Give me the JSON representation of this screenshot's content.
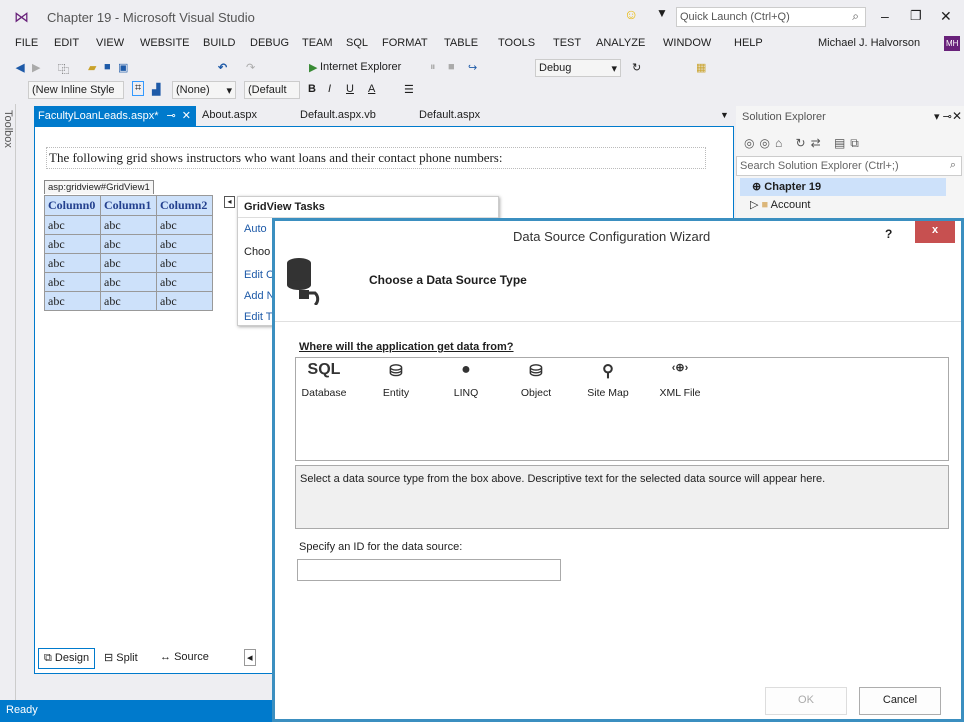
{
  "title": {
    "text": "Chapter 19 - Microsoft Visual Studio",
    "quick_launch": "Quick Launch (Ctrl+Q)",
    "user": "Michael J. Halvorson",
    "user_badge": "MH"
  },
  "menu": [
    "FILE",
    "EDIT",
    "VIEW",
    "WEBSITE",
    "BUILD",
    "DEBUG",
    "TEAM",
    "SQL",
    "FORMAT",
    "TABLE",
    "TOOLS",
    "TEST",
    "ANALYZE",
    "WINDOW",
    "HELP"
  ],
  "toolbar": {
    "browser": "Internet Explorer",
    "config": "Debug",
    "style": "(New Inline Style",
    "target": "(None)",
    "font": "(Default"
  },
  "toolbox_label": "Toolbox",
  "tabs": [
    {
      "label": "FacultyLoanLeads.aspx*"
    },
    {
      "label": "About.aspx"
    },
    {
      "label": "Default.aspx.vb"
    },
    {
      "label": "Default.aspx"
    }
  ],
  "editor": {
    "intro": "The following grid shows instructors who want loans and their contact phone numbers:",
    "grid_tag": "asp:gridview#GridView1",
    "columns": [
      "Column0",
      "Column1",
      "Column2"
    ],
    "rows": [
      [
        "abc",
        "abc",
        "abc"
      ],
      [
        "abc",
        "abc",
        "abc"
      ],
      [
        "abc",
        "abc",
        "abc"
      ],
      [
        "abc",
        "abc",
        "abc"
      ],
      [
        "abc",
        "abc",
        "abc"
      ]
    ],
    "tasks_title": "GridView Tasks",
    "tasks": [
      "Auto",
      "Choo",
      "Edit C",
      "Add N",
      "Edit T"
    ]
  },
  "views": {
    "design": "Design",
    "split": "Split",
    "source": "Source"
  },
  "solution": {
    "title": "Solution Explorer",
    "search": "Search Solution Explorer (Ctrl+;)",
    "root": "Chapter 19",
    "item1": "Account"
  },
  "status": "Ready",
  "wizard": {
    "title": "Data Source Configuration Wizard",
    "help": "?",
    "close": "x",
    "heading": "Choose a Data Source Type",
    "question": "Where will the application get data from?",
    "types": [
      {
        "label": "Database",
        "icon": "SQL"
      },
      {
        "label": "Entity",
        "icon": "entity-icon"
      },
      {
        "label": "LINQ",
        "icon": "linq-icon"
      },
      {
        "label": "Object",
        "icon": "object-icon"
      },
      {
        "label": "Site Map",
        "icon": "sitemap-icon"
      },
      {
        "label": "XML File",
        "icon": "‹⊕›"
      }
    ],
    "description": "Select a data source type from the box above. Descriptive text for the selected data source will appear here.",
    "id_label": "Specify an ID for the data source:",
    "id_value": "",
    "ok": "OK",
    "cancel": "Cancel"
  }
}
